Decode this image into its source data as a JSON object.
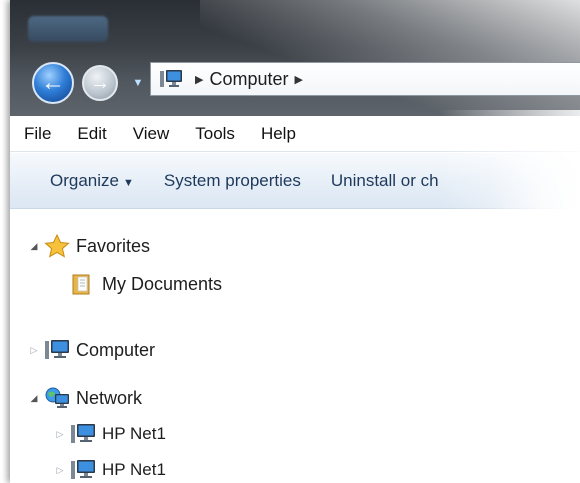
{
  "address_bar": {
    "path": [
      {
        "label": "Computer"
      }
    ]
  },
  "menu": {
    "items": [
      {
        "label": "File"
      },
      {
        "label": "Edit"
      },
      {
        "label": "View"
      },
      {
        "label": "Tools"
      },
      {
        "label": "Help"
      }
    ]
  },
  "commands": {
    "organize": "Organize",
    "system_properties": "System properties",
    "uninstall": "Uninstall or ch"
  },
  "tree": {
    "favorites": "Favorites",
    "my_documents": "My Documents",
    "computer": "Computer",
    "network": "Network",
    "net_items": [
      {
        "label": "HP Net1"
      },
      {
        "label": "HP Net1"
      }
    ]
  },
  "colors": {
    "selection_fill": "#dcebfc",
    "selection_border": "#a7c8ee",
    "command_text": "#1e395b",
    "back_button": "#2f7ed8"
  },
  "icons": {
    "back": "arrow-left-icon",
    "forward": "arrow-right-icon",
    "computer": "computer-icon",
    "favorites": "star-icon",
    "documents": "folder-icon",
    "network": "network-globe-icon"
  }
}
